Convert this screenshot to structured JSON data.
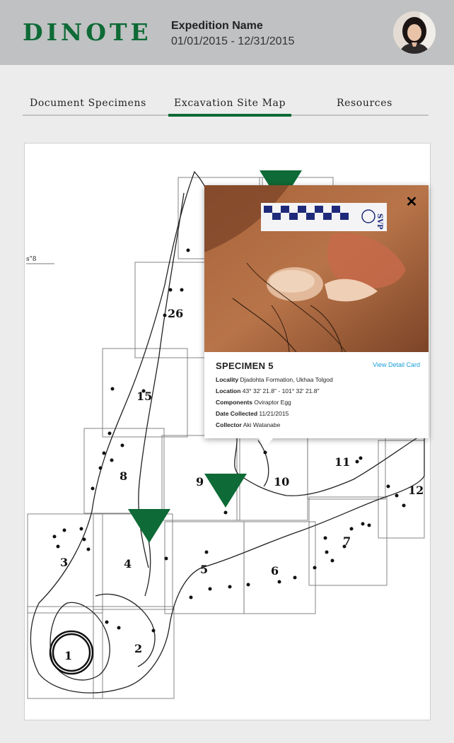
{
  "brand": {
    "logo_text": "DINOTE",
    "color": "#0e6a36"
  },
  "expedition": {
    "name": "Expedition Name",
    "dates": "01/01/2015 - 12/31/2015"
  },
  "tabs": [
    {
      "label": "Document Specimens",
      "active": false
    },
    {
      "label": "Excavation Site Map",
      "active": true
    },
    {
      "label": "Resources",
      "active": false
    }
  ],
  "map": {
    "scale_label": "s\"8",
    "quadrant_numbers": [
      "1",
      "2",
      "3",
      "4",
      "5",
      "6",
      "7",
      "8",
      "9",
      "10",
      "11",
      "12",
      "15",
      "26"
    ]
  },
  "specimen_popup": {
    "title": "SPECIMEN 5",
    "detail_link": "View Detail Card",
    "scale_bar_text": "SVP",
    "rows": [
      {
        "label": "Locality",
        "value": "Djadohta Formation, Ukhaa Tolgod"
      },
      {
        "label": "Location",
        "value": "43° 32' 21.8\" -  101° 32' 21.8\""
      },
      {
        "label": "Components",
        "value": "Oviraptor Egg"
      },
      {
        "label": "Date Collected",
        "value": "11/21/2015"
      },
      {
        "label": "Collector",
        "value": "Aki Watanabe"
      }
    ]
  }
}
